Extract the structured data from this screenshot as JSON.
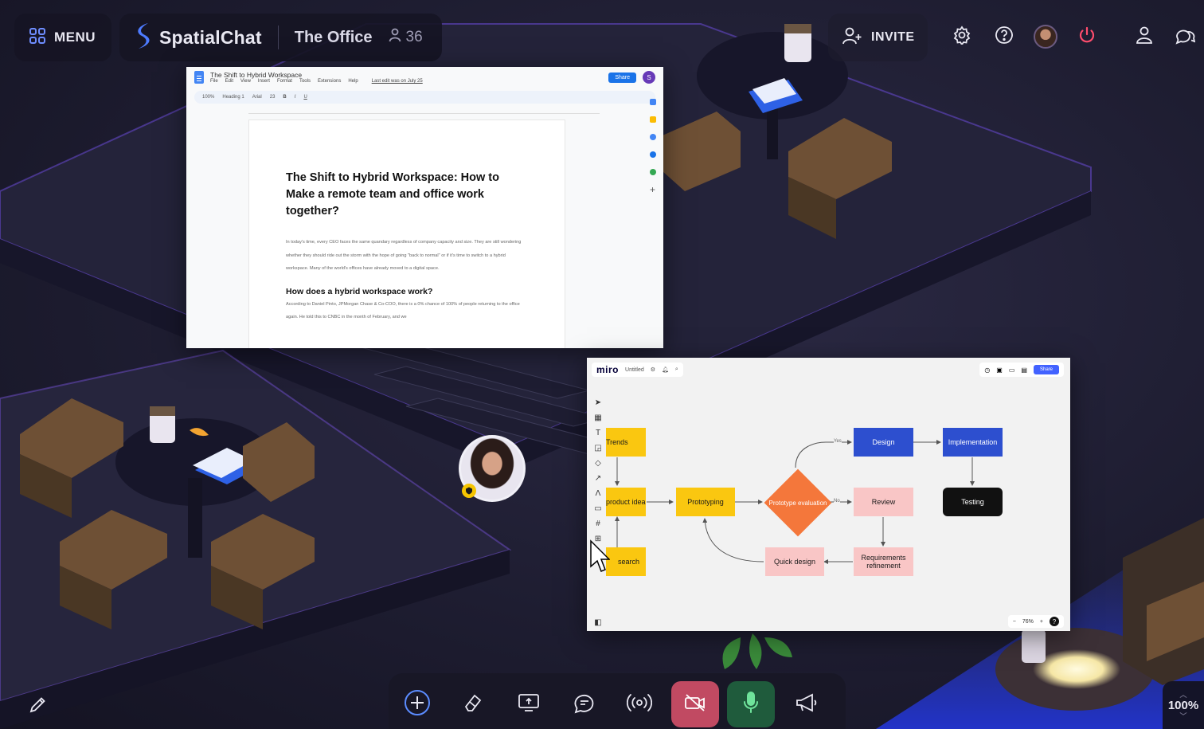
{
  "topbar": {
    "menu_label": "MENU",
    "brand_name": "SpatialChat",
    "room_name": "The Office",
    "participant_count": "36",
    "invite_label": "INVITE"
  },
  "doc": {
    "title": "The Shift to Hybrid Workspace",
    "menus": [
      "File",
      "Edit",
      "View",
      "Insert",
      "Format",
      "Tools",
      "Extensions",
      "Help"
    ],
    "last_edit": "Last edit was on July 25",
    "share_label": "Share",
    "user_initial": "S",
    "toolbar": {
      "zoom": "100%",
      "style": "Heading 1",
      "font": "Arial",
      "size": "23"
    },
    "heading": "The Shift to Hybrid Workspace: How to Make a remote team and office work together?",
    "paragraph1": "In today's time, every CEO faces the same quandary regardless of company capacity and size. They are still wondering whether they should ride out the storm with the hope of going \"back to normal\" or if it's time to switch to a hybrid workspace. Many of the world's offices have already moved to a digital space.",
    "subheading": "How does a hybrid workspace work?",
    "paragraph2": "According to Daniel Pinto, JPMorgan Chase & Co-COO, there is a 0% chance of 100% of people returning to the office again. He told this to CNBC in the month of February, and we"
  },
  "miro": {
    "logo": "miro",
    "board_name": "Untitled",
    "share_label": "Share",
    "zoom": "76%",
    "help": "?",
    "nodes": {
      "trends": "Trends",
      "product_idea": "product idea",
      "search": "search",
      "prototyping": "Prototyping",
      "prototype_evaluation": "Prototype evaluation",
      "design": "Design",
      "implementation": "Implementation",
      "review": "Review",
      "testing": "Testing",
      "quick_design": "Quick design",
      "requirements_refinement": "Requirements refinement"
    },
    "edge_yes": "Yes",
    "edge_no": "No"
  },
  "zoom_level": "100%",
  "colors": {
    "accent_blue": "#5b8cff",
    "camera_off": "#c14a62",
    "mic_on": "#1f5b3c",
    "power": "#ff4d6d"
  },
  "icons": [
    "grid-icon",
    "spatialchat-logo-icon",
    "user-icon",
    "add-user-icon",
    "gear-icon",
    "help-icon",
    "power-icon",
    "profile-icon",
    "chat-icon",
    "pencil-icon",
    "plus-icon",
    "eraser-icon",
    "screen-share-icon",
    "message-icon",
    "broadcast-icon",
    "camera-off-icon",
    "microphone-icon",
    "megaphone-icon"
  ]
}
